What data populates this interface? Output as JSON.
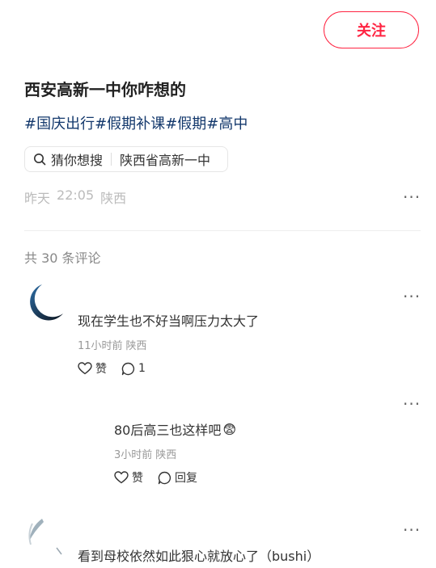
{
  "header": {
    "follow_label": "关注"
  },
  "post": {
    "title": "西安高新一中你咋想的",
    "tags": [
      "#国庆出行",
      "#假期补课",
      "#假期",
      "#高中"
    ],
    "search_chip": {
      "label": "猜你想搜",
      "query": "陕西省高新一中"
    },
    "date": "昨天",
    "time": "22:05",
    "location": "陕西"
  },
  "comments_header": "共 30 条评论",
  "comments": [
    {
      "text": "现在学生也不好当啊压力太大了",
      "time": "11小时前",
      "location": "陕西",
      "like_label": "赞",
      "reply_label": "1"
    },
    {
      "text": "80后高三也这样吧",
      "emoji": "😨",
      "time": "3小时前",
      "location": "陕西",
      "like_label": "赞",
      "reply_label": "回复"
    },
    {
      "text": "看到母校依然如此狠心就放心了（bushi）"
    }
  ],
  "icons": {
    "search": "search-icon",
    "heart": "heart-icon",
    "comment": "comment-icon",
    "more": "more-icon"
  },
  "colors": {
    "accent": "#ff2442",
    "tag": "#13386c",
    "muted": "#bbbbbb"
  }
}
